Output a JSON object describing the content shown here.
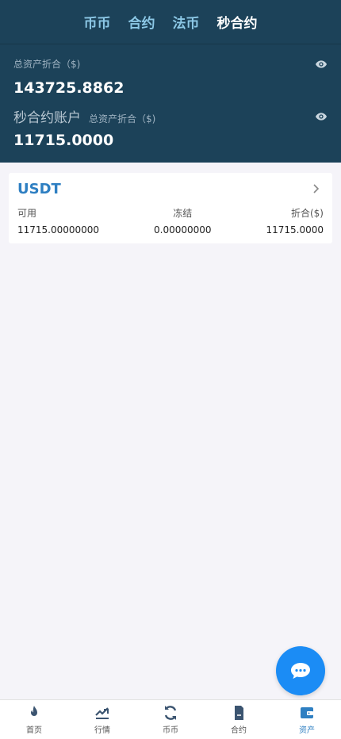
{
  "tabs": [
    {
      "label": "币币",
      "active": false
    },
    {
      "label": "合约",
      "active": false
    },
    {
      "label": "法币",
      "active": false
    },
    {
      "label": "秒合约",
      "active": true
    }
  ],
  "summary": {
    "total_label": "总资产折合（$)",
    "total_value": "143725.8862",
    "account_label": "秒合约账户",
    "account_sub_label": "总资产折合（$)",
    "account_value": "11715.0000"
  },
  "asset_card": {
    "currency": "USDT",
    "available_label": "可用",
    "available_value": "11715.00000000",
    "frozen_label": "冻结",
    "frozen_value": "0.00000000",
    "converted_label": "折合($)",
    "converted_value": "11715.0000"
  },
  "bottom_nav": [
    {
      "label": "首页",
      "icon": "fire-icon",
      "active": false
    },
    {
      "label": "行情",
      "icon": "chart-icon",
      "active": false
    },
    {
      "label": "币币",
      "icon": "exchange-icon",
      "active": false
    },
    {
      "label": "合约",
      "icon": "document-icon",
      "active": false
    },
    {
      "label": "资产",
      "icon": "wallet-icon",
      "active": true
    }
  ],
  "colors": {
    "header_bg": "#1c4259",
    "accent": "#2e7fc2",
    "fab": "#1b8cf5",
    "page_bg": "#f5f4f9"
  }
}
